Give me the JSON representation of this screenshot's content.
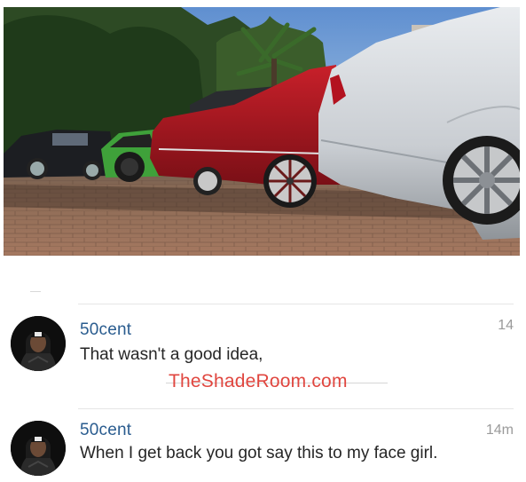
{
  "photo": {
    "description_icon": "cars-parked-photo"
  },
  "comments": [
    {
      "username": "50cent",
      "text": "That wasn't a good idea,",
      "timestamp": "14"
    },
    {
      "username": "50cent",
      "text": "When I get back you got say this to my face girl.",
      "timestamp": "14m"
    }
  ],
  "watermark": "TheShadeRoom.com",
  "colors": {
    "username": "#2a5c8f",
    "watermark": "#e0463f",
    "timestamp": "#9a9a9a"
  }
}
